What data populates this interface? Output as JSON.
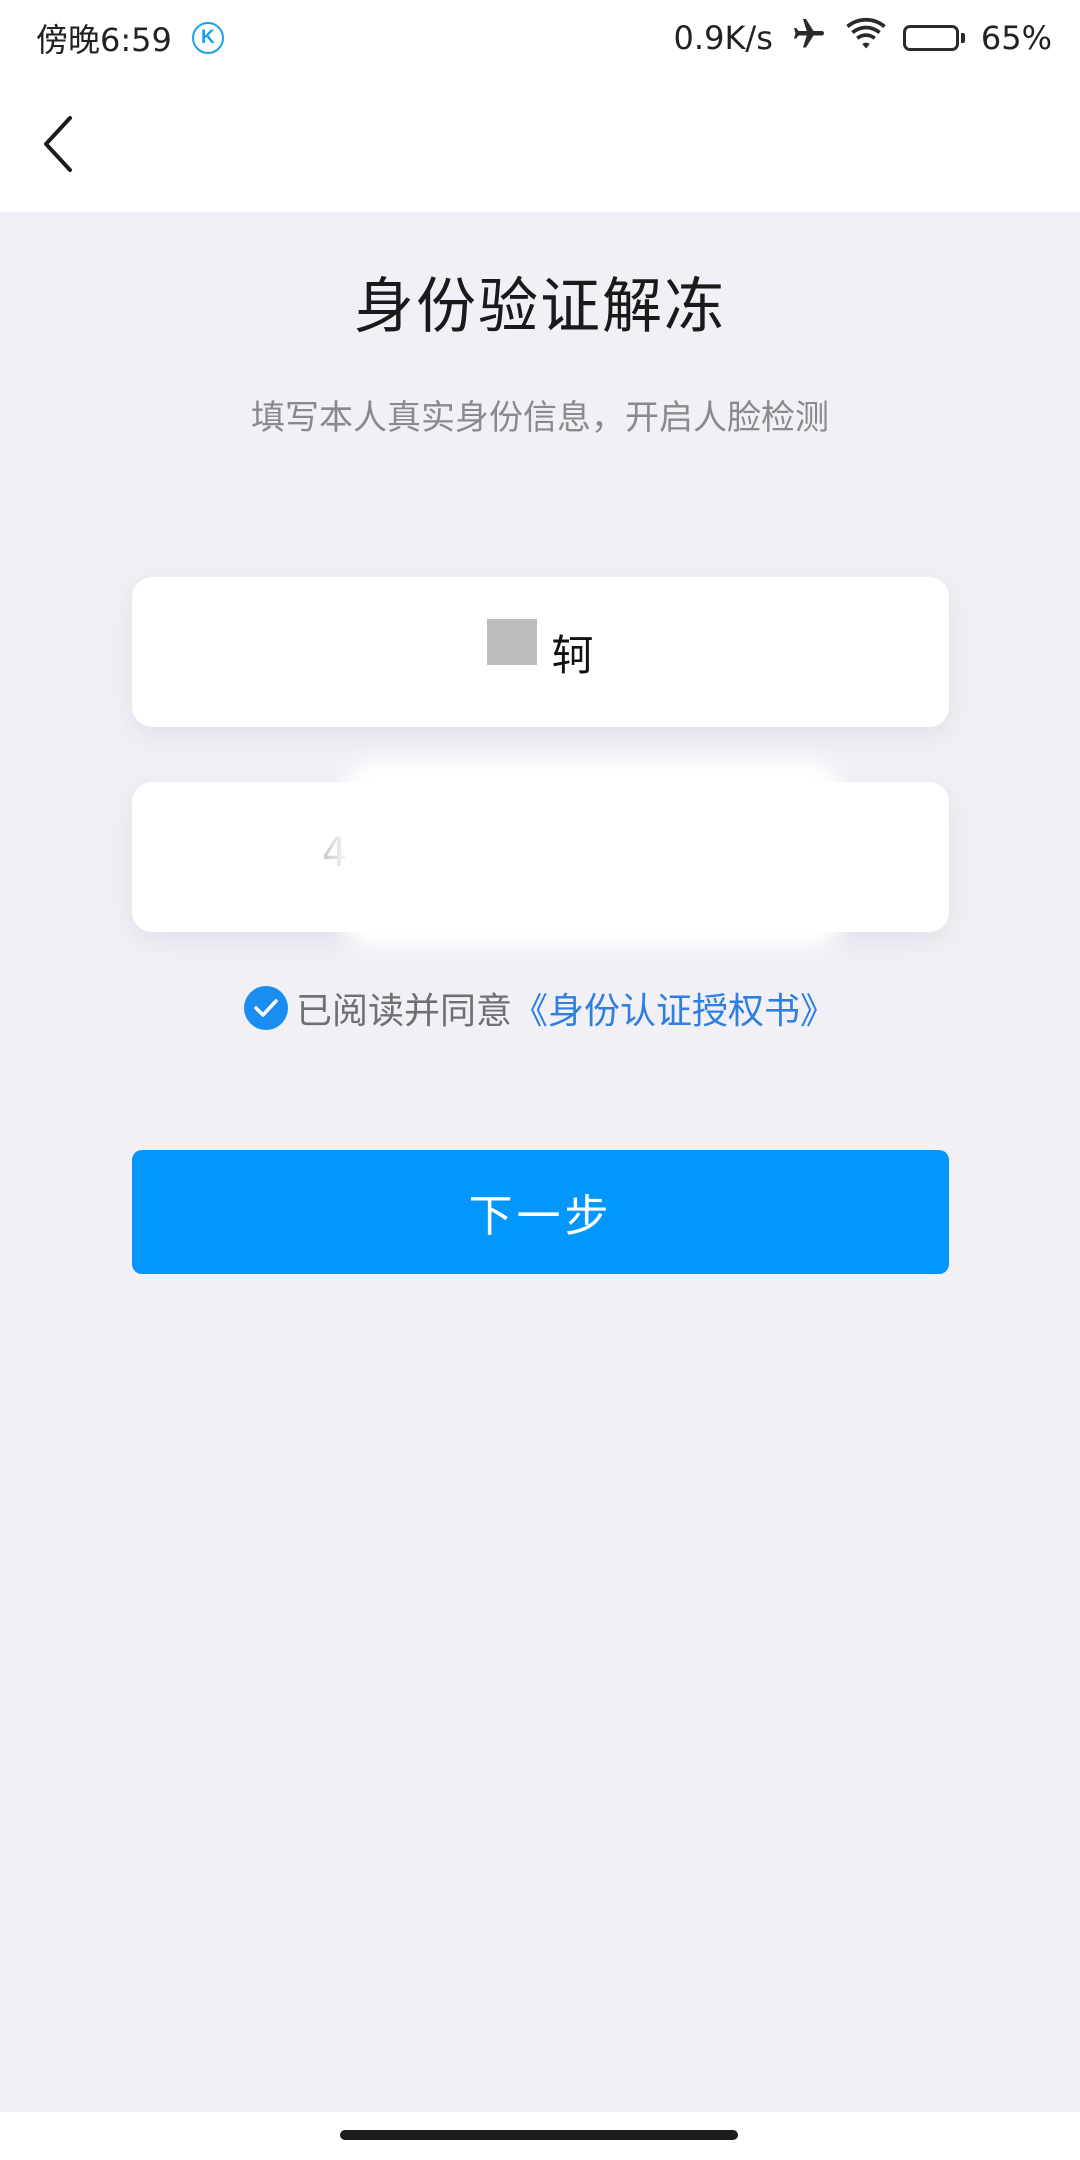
{
  "status_bar": {
    "time": "傍晚6:59",
    "network_speed": "0.9K/s",
    "battery_percent": "65%",
    "battery_level": 0.65,
    "icons": [
      "k-app-icon",
      "airplane-icon",
      "wifi-icon",
      "battery-icon"
    ]
  },
  "nav": {
    "back_icon": "back-chevron-icon"
  },
  "page": {
    "title": "身份验证解冻",
    "subtitle": "填写本人真实身份信息，开启人脸检测"
  },
  "form": {
    "name_value": "轲",
    "id_value": "4"
  },
  "agreement": {
    "checked": true,
    "prefix": "已阅读并同意",
    "link": "《身份认证授权书》"
  },
  "next_button": {
    "label": "下一步"
  },
  "colors": {
    "primary": "#0397fb",
    "link": "#2f7fe0",
    "background": "#f0f0f6",
    "battery": "#f2b53c"
  }
}
